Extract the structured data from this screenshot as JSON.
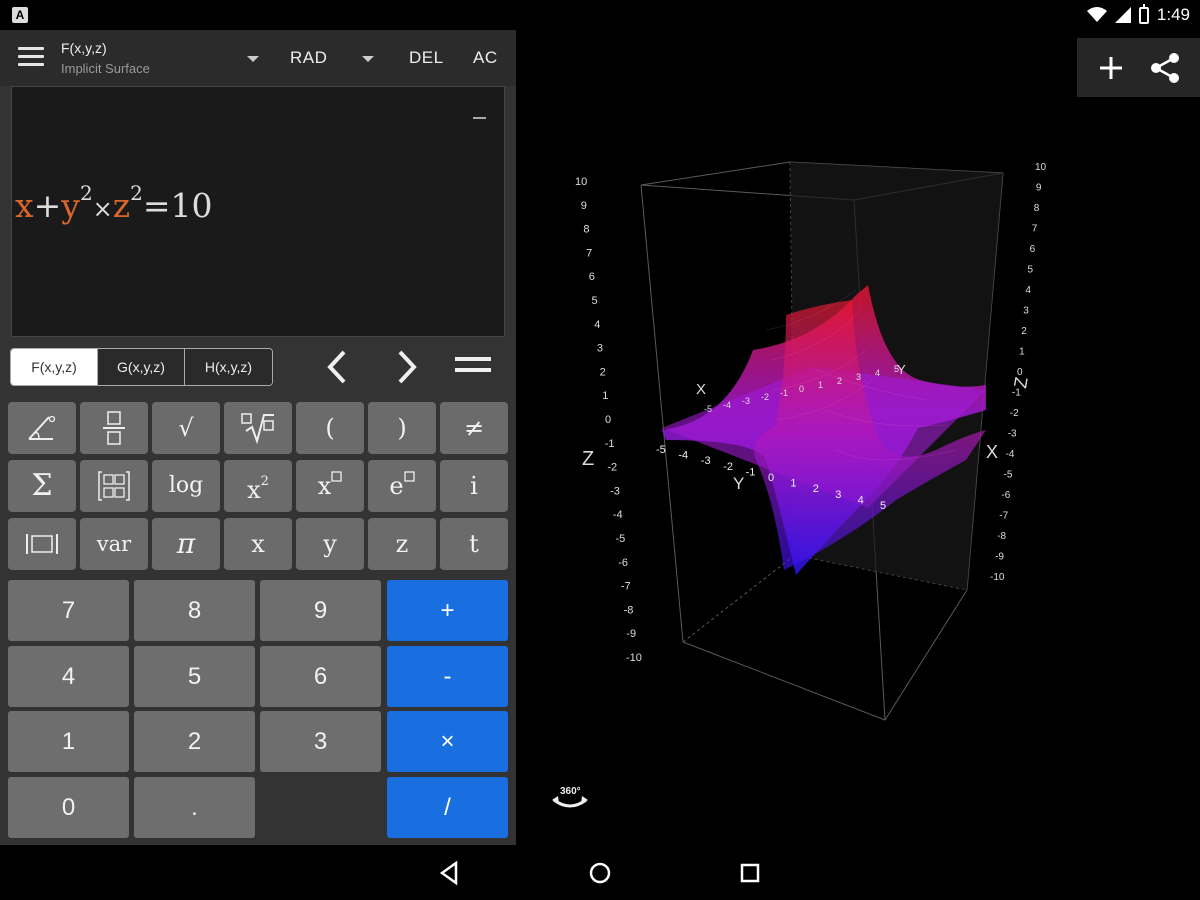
{
  "status_bar": {
    "time": "1:49"
  },
  "toolbar": {
    "function_title": "F(x,y,z)",
    "function_subtitle": "Implicit Surface",
    "angle_mode": "RAD",
    "del_label": "DEL",
    "ac_label": "AC"
  },
  "expression": {
    "v1": "x",
    "op1": "+",
    "v2": "y",
    "exp1": "2",
    "op2": "×",
    "v3": "z",
    "exp2": "2",
    "rhs": "=10"
  },
  "function_tabs": [
    "F(x,y,z)",
    "G(x,y,z)",
    "H(x,y,z)"
  ],
  "function_keys": {
    "row1": [
      "(",
      ")",
      "≠"
    ],
    "row2": {
      "log": "log",
      "x": "x",
      "sq": "2",
      "e": "e",
      "i": "i"
    },
    "row3": {
      "var": "var",
      "pi": "π",
      "x": "x",
      "y": "y",
      "z": "z",
      "t": "t"
    }
  },
  "number_keys": [
    "7",
    "8",
    "9",
    "4",
    "5",
    "6",
    "1",
    "2",
    "3",
    "0",
    "."
  ],
  "operator_keys": [
    "+",
    "-",
    "×",
    "/"
  ],
  "graph": {
    "z_ticks": [
      "10",
      "9",
      "8",
      "7",
      "6",
      "5",
      "4",
      "3",
      "2",
      "1",
      "0",
      "-1",
      "-2",
      "-3",
      "-4",
      "-5",
      "-6",
      "-7",
      "-8",
      "-9",
      "-10"
    ],
    "axis_labels": {
      "left_z": "Z",
      "right_z": "Z",
      "x_top": "X",
      "x_right": "X",
      "y_bottom": "Y",
      "y_top": "Y"
    },
    "y_ticks": [
      "-5",
      "-4",
      "-3",
      "-2",
      "-1",
      "0",
      "1",
      "2",
      "3",
      "4",
      "5"
    ],
    "x_ticks": [
      "-5",
      "-4",
      "-3",
      "-2",
      "-1",
      "0",
      "1",
      "2",
      "3",
      "4",
      "5"
    ],
    "rotate_label": "360°",
    "colors": {
      "surface_top": "#e0142a",
      "surface_mid": "#a11ad6",
      "surface_bottom": "#2a14e6"
    }
  }
}
